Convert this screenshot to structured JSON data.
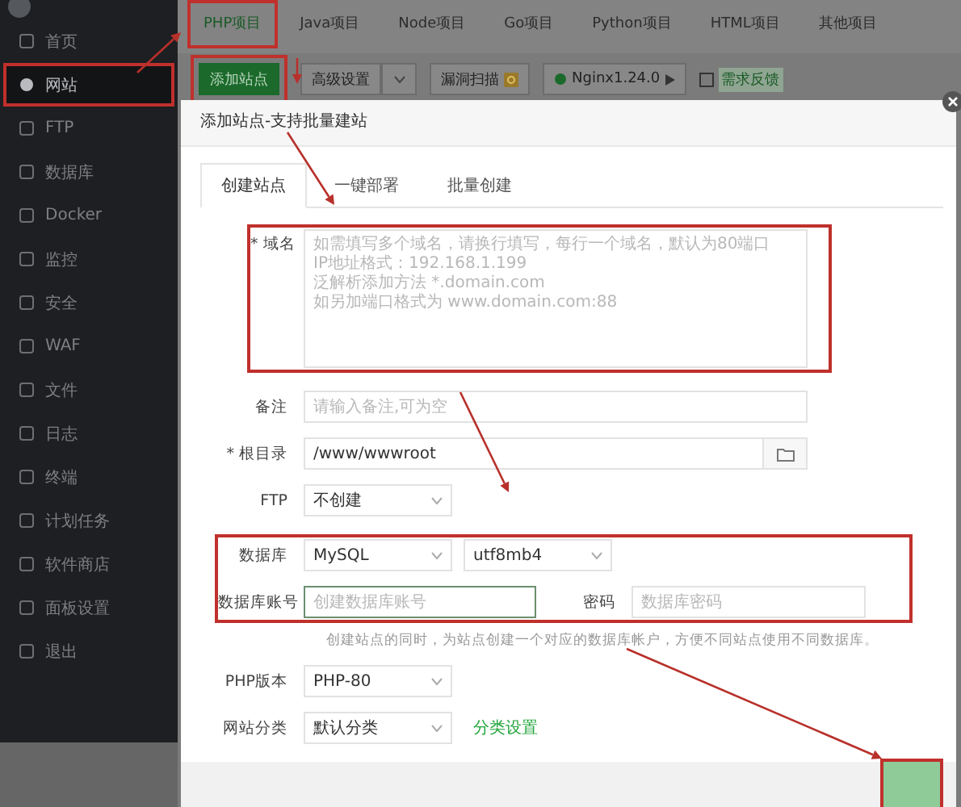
{
  "sidebar": {
    "items": [
      {
        "label": "首页",
        "selected": false,
        "annotated": false
      },
      {
        "label": "网站",
        "selected": true,
        "annotated": true
      },
      {
        "label": "FTP",
        "selected": false,
        "annotated": false
      },
      {
        "label": "数据库",
        "selected": false,
        "annotated": false
      },
      {
        "label": "Docker",
        "selected": false,
        "annotated": false
      },
      {
        "label": "监控",
        "selected": false,
        "annotated": false
      },
      {
        "label": "安全",
        "selected": false,
        "annotated": false
      },
      {
        "label": "WAF",
        "selected": false,
        "annotated": false
      },
      {
        "label": "文件",
        "selected": false,
        "annotated": false
      },
      {
        "label": "日志",
        "selected": false,
        "annotated": false
      },
      {
        "label": "终端",
        "selected": false,
        "annotated": false
      },
      {
        "label": "计划任务",
        "selected": false,
        "annotated": false
      },
      {
        "label": "软件商店",
        "selected": false,
        "annotated": false
      },
      {
        "label": "面板设置",
        "selected": false,
        "annotated": false
      },
      {
        "label": "退出",
        "selected": false,
        "annotated": false
      }
    ]
  },
  "project_tabs": [
    {
      "label": "PHP项目",
      "selected": true,
      "annotated": true
    },
    {
      "label": "Java项目",
      "selected": false,
      "annotated": false
    },
    {
      "label": "Node项目",
      "selected": false,
      "annotated": false
    },
    {
      "label": "Go项目",
      "selected": false,
      "annotated": false
    },
    {
      "label": "Python项目",
      "selected": false,
      "annotated": false
    },
    {
      "label": "HTML项目",
      "selected": false,
      "annotated": false
    },
    {
      "label": "其他项目",
      "selected": false,
      "annotated": false
    }
  ],
  "toolbar": {
    "add_button": {
      "label": "添加站点",
      "annotated": true
    },
    "settings_button": {
      "label": "高级设置"
    },
    "scan_button": {
      "label": "漏洞扫描"
    },
    "server_button": {
      "label": "Nginx1.24.0"
    },
    "feedback_link": {
      "label": "需求反馈"
    }
  },
  "dialog": {
    "title": "添加站点-支持批量建站",
    "tabs": [
      {
        "label": "创建站点",
        "selected": true
      },
      {
        "label": "一键部署",
        "selected": false
      },
      {
        "label": "批量创建",
        "selected": false
      }
    ],
    "sections": [
      {
        "annotated": true,
        "rows": [
          {
            "kind": "textarea",
            "label": "* 域名",
            "placeholder": "如需填写多个域名，请换行填写，每行一个域名，默认为80端口\nIP地址格式：192.168.1.199\n泛解析添加方法 *.domain.com\n如另加端口格式为 www.domain.com:88"
          }
        ]
      },
      {
        "annotated": false,
        "rows": [
          {
            "kind": "input",
            "label": "备注",
            "placeholder": "请输入备注,可为空"
          },
          {
            "kind": "path",
            "label": "* 根目录",
            "value": "/www/wwwroot"
          },
          {
            "kind": "select",
            "label": "FTP",
            "selects": [
              "不创建"
            ]
          }
        ]
      },
      {
        "annotated": true,
        "rows": [
          {
            "kind": "select",
            "label": "数据库",
            "selects": [
              "MySQL",
              "utf8mb4"
            ]
          },
          {
            "kind": "credentials",
            "label": "数据库账号",
            "placeholder": "创建数据库账号",
            "focused": true,
            "second_label": "密码",
            "second_placeholder": "数据库密码"
          }
        ]
      },
      {
        "annotated": false,
        "rows": [
          {
            "kind": "hint",
            "text": "创建站点的同时，为站点创建一个对应的数据库帐户，方便不同站点使用不同数据库。"
          },
          {
            "kind": "select",
            "label": "PHP版本",
            "selects": [
              "PHP-80"
            ]
          },
          {
            "kind": "select",
            "label": "网站分类",
            "selects": [
              "默认分类"
            ],
            "link": "分类设置"
          }
        ]
      }
    ],
    "footer": {
      "submit_annotated": true
    }
  }
}
